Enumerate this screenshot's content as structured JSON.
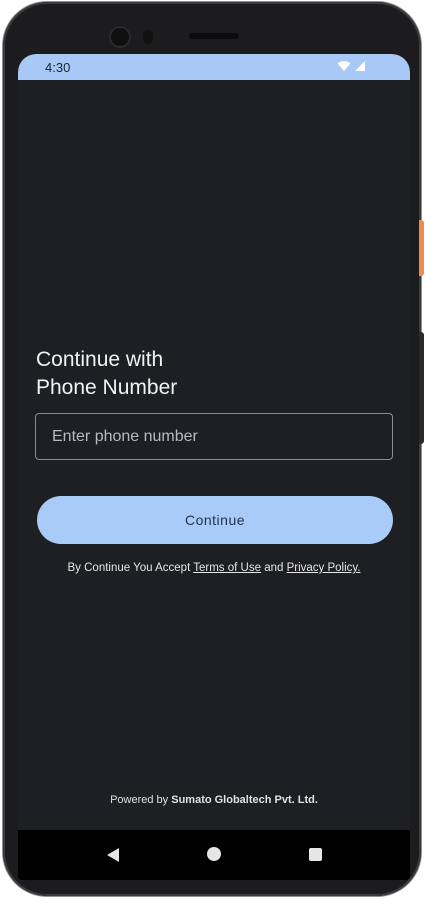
{
  "status_bar": {
    "time": "4:30",
    "icons": [
      "wifi-icon",
      "cellular-signal-icon"
    ]
  },
  "login": {
    "title_line1": "Continue with",
    "title_line2": "Phone Number",
    "phone_placeholder": "Enter phone number",
    "phone_value": "",
    "continue_label": "Continue",
    "terms_prefix": "By Continue You Accept ",
    "terms_link": "Terms of Use",
    "terms_and": " and ",
    "privacy_link": "Privacy Policy."
  },
  "footer": {
    "powered_prefix": "Powered by ",
    "company": "Sumato Globaltech Pvt. Ltd."
  },
  "nav_bar": {
    "icons": [
      "back-icon",
      "home-icon",
      "recents-icon"
    ]
  },
  "colors": {
    "status_bar": "#a8c8f5",
    "background": "#1e1f22",
    "button": "#a9cbf7",
    "button_text": "#1f3450"
  }
}
